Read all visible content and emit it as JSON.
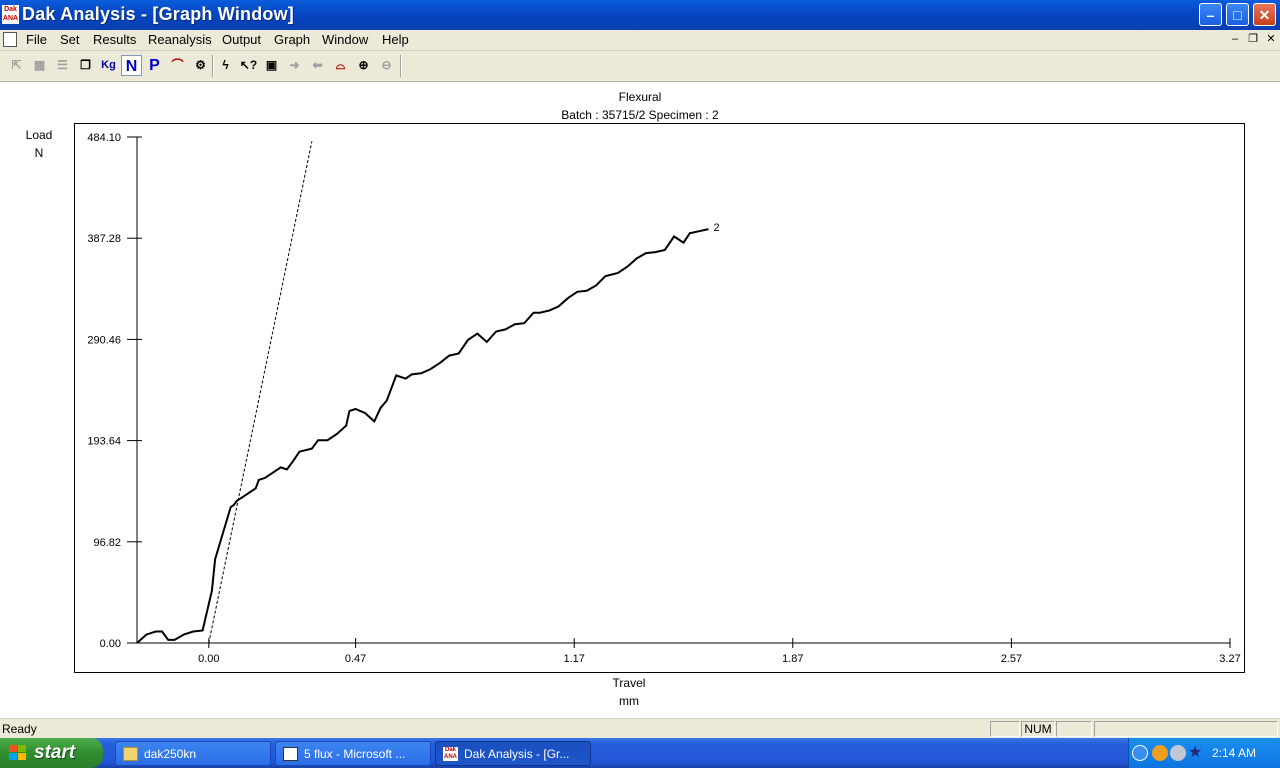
{
  "window": {
    "title": "Dak Analysis - [Graph Window]",
    "app_icon_text": [
      "Dak",
      "ANA"
    ]
  },
  "menu": {
    "items": [
      "File",
      "Set",
      "Results",
      "Reanalysis",
      "Output",
      "Graph",
      "Window",
      "Help"
    ]
  },
  "toolbar": {
    "kg_label": "Kg",
    "n_label": "N",
    "p_label": "P"
  },
  "chart_data": {
    "type": "line",
    "title": "Flexural",
    "subtitle": "Batch : 35715/2 Specimen : 2",
    "ylabel": "Load",
    "yunit": "N",
    "xlabel": "Travel",
    "xunit": "mm",
    "xlim": [
      -0.23,
      3.27
    ],
    "ylim": [
      0,
      484.1
    ],
    "xticks": [
      "0.00",
      "0.47",
      "1.17",
      "1.87",
      "2.57",
      "3.27"
    ],
    "xtick_values": [
      0.0,
      0.47,
      1.17,
      1.87,
      2.57,
      3.27
    ],
    "yticks": [
      "0.00",
      "96.82",
      "193.64",
      "290.46",
      "387.28",
      "484.10"
    ],
    "ytick_values": [
      0.0,
      96.82,
      193.64,
      290.46,
      387.28,
      484.1
    ],
    "grid": false,
    "series": [
      {
        "name": "2",
        "style": "solid",
        "x": [
          -0.23,
          -0.2,
          -0.17,
          -0.15,
          -0.13,
          -0.11,
          -0.08,
          -0.05,
          -0.02,
          0.01,
          0.02,
          0.04,
          0.07,
          0.08,
          0.09,
          0.11,
          0.15,
          0.16,
          0.18,
          0.2,
          0.23,
          0.25,
          0.27,
          0.29,
          0.33,
          0.35,
          0.38,
          0.41,
          0.44,
          0.45,
          0.47,
          0.5,
          0.53,
          0.55,
          0.57,
          0.6,
          0.63,
          0.65,
          0.68,
          0.71,
          0.74,
          0.77,
          0.8,
          0.83,
          0.86,
          0.89,
          0.92,
          0.95,
          0.98,
          1.01,
          1.04,
          1.06,
          1.09,
          1.12,
          1.15,
          1.18,
          1.21,
          1.24,
          1.27,
          1.31,
          1.34,
          1.37,
          1.4,
          1.43,
          1.46,
          1.49,
          1.52,
          1.54,
          1.57,
          1.6
        ],
        "y": [
          0,
          8,
          11,
          11,
          3,
          3,
          8,
          11,
          12,
          50,
          80,
          100,
          130,
          132,
          136,
          140,
          148,
          156,
          158,
          162,
          168,
          166,
          174,
          183,
          186,
          194,
          194,
          200,
          208,
          222,
          224,
          220,
          212,
          225,
          232,
          256,
          253,
          257,
          258,
          262,
          268,
          275,
          277,
          290,
          296,
          288,
          298,
          300,
          305,
          306,
          316,
          316,
          318,
          322,
          330,
          336,
          337,
          342,
          351,
          354,
          360,
          368,
          373,
          374,
          376,
          389,
          383,
          392,
          394,
          396
        ]
      },
      {
        "name": "",
        "style": "dashed",
        "x": [
          0.0,
          0.33
        ],
        "y": [
          0,
          480
        ]
      }
    ],
    "annotations": [
      "2"
    ]
  },
  "status": {
    "text": "Ready",
    "num": "NUM"
  },
  "taskbar": {
    "start_label": "start",
    "tasks": [
      "dak250kn",
      "5 flux - Microsoft ...",
      "Dak Analysis - [Gr..."
    ],
    "clock": "2:14 AM"
  },
  "colors": {
    "titlebar": "#0646c2",
    "chrome": "#ece9d8",
    "taskbar": "#245edb",
    "start": "#2f8f2f"
  }
}
